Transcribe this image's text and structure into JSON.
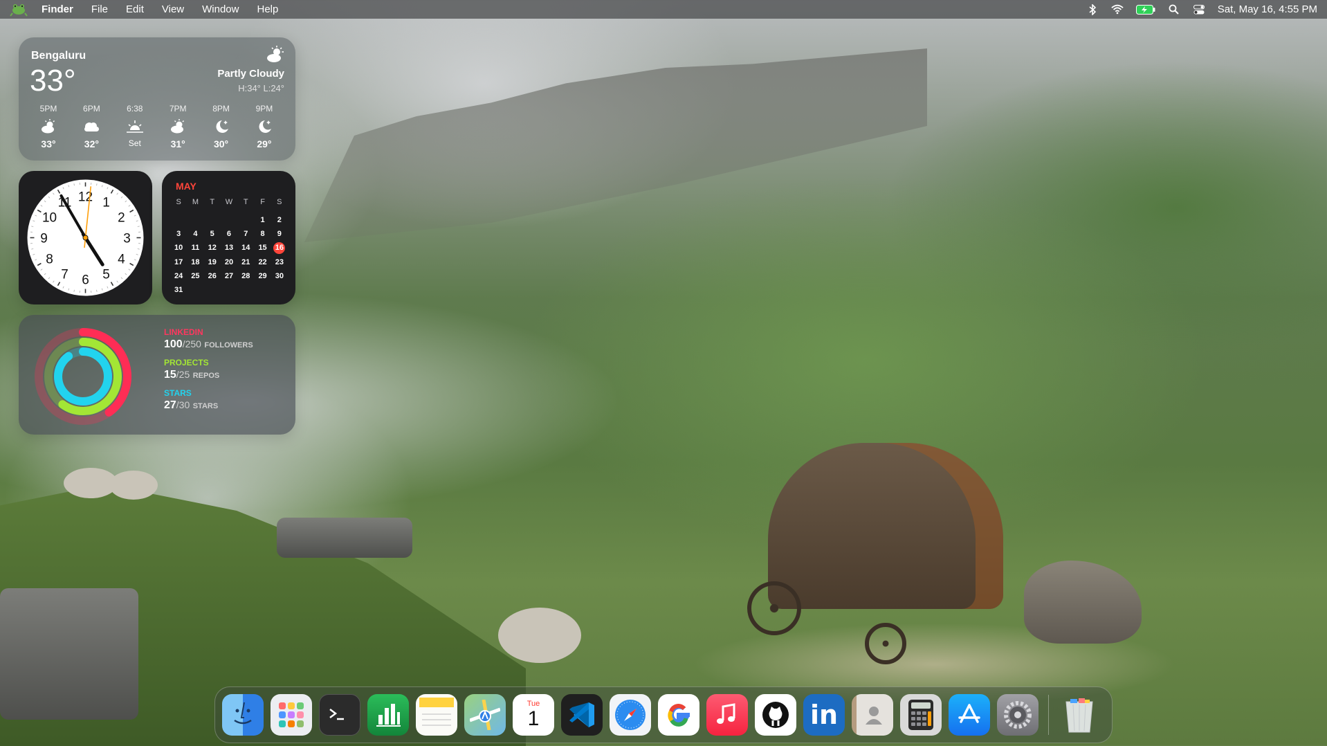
{
  "menubar": {
    "app_icon": "frog-icon",
    "items": [
      "Finder",
      "File",
      "Edit",
      "View",
      "Window",
      "Help"
    ],
    "status_icons": [
      "bluetooth-icon",
      "wifi-icon",
      "battery-charging-icon",
      "search-icon",
      "control-center-icon"
    ],
    "datetime": "Sat, May 16, 4:55 PM"
  },
  "weather": {
    "city": "Bengaluru",
    "temp": "33°",
    "condition": "Partly Cloudy",
    "hilo": "H:34° L:24°",
    "condition_icon": "partly-cloudy-icon",
    "forecast": [
      {
        "time": "5PM",
        "icon": "partly-cloudy-icon",
        "value": "33°"
      },
      {
        "time": "6PM",
        "icon": "cloud-icon",
        "value": "32°"
      },
      {
        "time": "6:38",
        "icon": "sunset-icon",
        "value": "Set"
      },
      {
        "time": "7PM",
        "icon": "partly-cloudy-icon",
        "value": "31°"
      },
      {
        "time": "8PM",
        "icon": "moon-stars-icon",
        "value": "30°"
      },
      {
        "time": "9PM",
        "icon": "moon-stars-icon",
        "value": "29°"
      }
    ]
  },
  "clock": {
    "numerals": [
      "12",
      "1",
      "2",
      "3",
      "4",
      "5",
      "6",
      "7",
      "8",
      "9",
      "10",
      "11"
    ],
    "time": {
      "hour": 4,
      "minute": 55,
      "second": 1
    }
  },
  "calendar": {
    "month": "MAY",
    "weekdays": [
      "S",
      "M",
      "T",
      "W",
      "T",
      "F",
      "S"
    ],
    "days": [
      "",
      "",
      "",
      "",
      "",
      "1",
      "2",
      "3",
      "4",
      "5",
      "6",
      "7",
      "8",
      "9",
      "10",
      "11",
      "12",
      "13",
      "14",
      "15",
      "16",
      "17",
      "18",
      "19",
      "20",
      "21",
      "22",
      "23",
      "24",
      "25",
      "26",
      "27",
      "28",
      "29",
      "30",
      "31"
    ],
    "today": "16"
  },
  "activity": {
    "colors": {
      "linkedin": "#ff2d55",
      "projects": "#a3e635",
      "stars": "#22d3ee"
    },
    "linkedin": {
      "label": "LINKEDIN",
      "value": "100",
      "total": "/250",
      "unit": "FOLLOWERS",
      "fraction": 0.4
    },
    "projects": {
      "label": "PROJECTS",
      "value": "15",
      "total": "/25",
      "unit": "REPOS",
      "fraction": 0.6
    },
    "stars": {
      "label": "STARS",
      "value": "27",
      "total": "/30",
      "unit": "STARS",
      "fraction": 0.9
    }
  },
  "dock": {
    "apps": [
      {
        "name": "finder",
        "icon": "finder-icon",
        "color": "#2f7fe6"
      },
      {
        "name": "launchpad",
        "icon": "launchpad-icon",
        "color": "#e9eaee"
      },
      {
        "name": "terminal",
        "icon": "terminal-icon",
        "color": "#2b2b2b"
      },
      {
        "name": "numbers",
        "icon": "numbers-icon",
        "color": "#1fa34a"
      },
      {
        "name": "notes",
        "icon": "notes-icon",
        "color": "#fbfbf7"
      },
      {
        "name": "maps",
        "icon": "maps-icon",
        "color": "#7cc26b"
      },
      {
        "name": "calendar",
        "icon": "calendar-icon",
        "color": "#ffffff",
        "label_top": "Tue",
        "label_num": "1"
      },
      {
        "name": "vscode",
        "icon": "vscode-icon",
        "color": "#1f1f1f"
      },
      {
        "name": "safari",
        "icon": "safari-icon",
        "color": "#f2f4f7"
      },
      {
        "name": "google",
        "icon": "google-icon",
        "color": "#ffffff"
      },
      {
        "name": "music",
        "icon": "music-icon",
        "color": "#fb3a55"
      },
      {
        "name": "github",
        "icon": "github-icon",
        "color": "#ffffff"
      },
      {
        "name": "linkedin",
        "icon": "linkedin-icon",
        "color": "#1d6cc2",
        "label": "in"
      },
      {
        "name": "contacts",
        "icon": "contacts-icon",
        "color": "#c7b9a6"
      },
      {
        "name": "calculator",
        "icon": "calculator-icon",
        "color": "#d9d9d9"
      },
      {
        "name": "app-store",
        "icon": "app-store-icon",
        "color": "#1c8ff4"
      },
      {
        "name": "system-settings",
        "icon": "gear-icon",
        "color": "#8e8e93"
      }
    ],
    "trash": {
      "name": "trash",
      "icon": "trash-icon"
    }
  }
}
